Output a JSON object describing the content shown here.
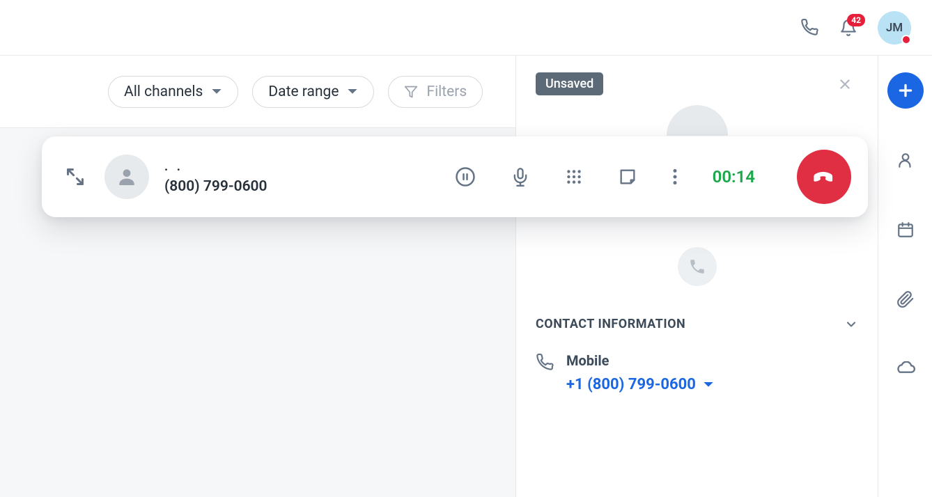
{
  "header": {
    "notification_count": "42",
    "avatar_initials": "JM"
  },
  "filters": {
    "channels_label": "All channels",
    "daterange_label": "Date range",
    "filters_label": "Filters"
  },
  "call": {
    "caller_name": ". .",
    "caller_number": "(800) 799-0600",
    "timer": "00:14"
  },
  "detail": {
    "tag_label": "Unsaved",
    "section_title": "CONTACT INFORMATION",
    "contact_type": "Mobile",
    "contact_number": "+1 (800) 799-0600"
  }
}
